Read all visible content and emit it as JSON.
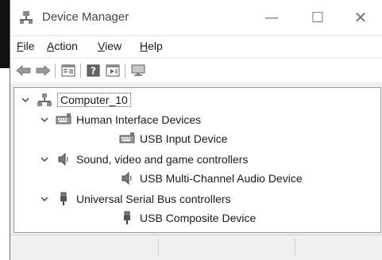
{
  "window": {
    "title": "Device Manager",
    "controls": {
      "minimize": "—",
      "maximize": "☐",
      "close": "✕"
    }
  },
  "menu": [
    {
      "key": "F",
      "rest": "ile"
    },
    {
      "key": "A",
      "rest": "ction"
    },
    {
      "key": "V",
      "rest": "iew"
    },
    {
      "key": "H",
      "rest": "elp"
    }
  ],
  "toolbar": {
    "icons": [
      "back-arrow-icon",
      "forward-arrow-icon",
      "properties-icon",
      "help-icon",
      "run-icon",
      "monitor-icon"
    ]
  },
  "tree": {
    "root": "Computer_10",
    "categories": [
      {
        "label": "Human Interface Devices",
        "icon": "hid-icon",
        "children": [
          "USB Input Device"
        ]
      },
      {
        "label": "Sound, video and game controllers",
        "icon": "speaker-icon",
        "children": [
          "USB Multi-Channel Audio Device"
        ]
      },
      {
        "label": "Universal Serial Bus controllers",
        "icon": "usb-icon",
        "children": [
          "USB Composite Device"
        ]
      }
    ]
  },
  "colors": {
    "window_bg": "#f0f0f0",
    "chrome_bg": "#ffffff",
    "border": "#9a9a9a"
  }
}
